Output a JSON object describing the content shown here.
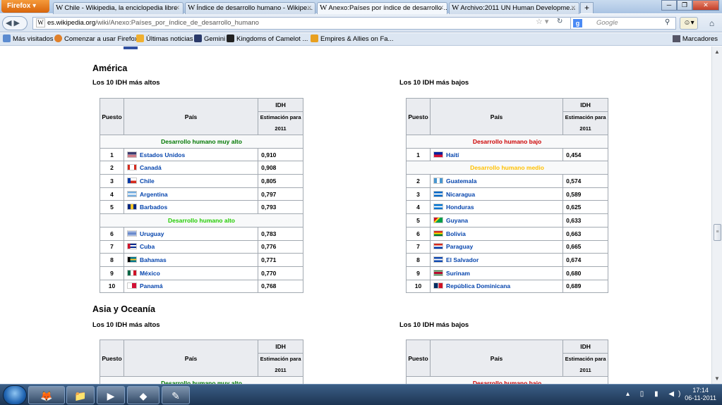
{
  "browser": {
    "menu_button": "Firefox ▾",
    "tabs": [
      {
        "label": "Chile - Wikipedia, la enciclopedia libre",
        "active": false
      },
      {
        "label": "Índice de desarrollo humano - Wikipe...",
        "active": false
      },
      {
        "label": "Anexo:Países por índice de desarrollo ...",
        "active": true
      },
      {
        "label": "Archivo:2011 UN Human Developme...",
        "active": false
      }
    ],
    "new_tab": "+",
    "url_domain": "es.wikipedia.org",
    "url_path": "/wiki/Anexo:Países_por_índice_de_desarrollo_humano",
    "search_placeholder": "Google",
    "bookmarks": [
      "Más visitados",
      "Comenzar a usar Firefox",
      "Últimas noticias",
      "Gemini",
      "Kingdoms of Camelot ...",
      "Empires & Allies on Fa..."
    ],
    "bookmarks_menu": "Marcadores"
  },
  "page": {
    "section1": {
      "heading": "América",
      "left_caption": "Los 10 IDH más altos",
      "right_caption": "Los 10 IDH más bajos",
      "col_puesto": "Puesto",
      "col_pais": "País",
      "col_idh": "IDH",
      "col_est": "Estimación para 2011",
      "left_groups": [
        {
          "category": "Desarrollo humano muy alto",
          "color": "#007700",
          "rows": [
            {
              "rank": "1",
              "country": "Estados Unidos",
              "value": "0,910"
            },
            {
              "rank": "2",
              "country": "Canadá",
              "value": "0,908"
            },
            {
              "rank": "3",
              "country": "Chile",
              "value": "0,805"
            },
            {
              "rank": "4",
              "country": "Argentina",
              "value": "0,797"
            },
            {
              "rank": "5",
              "country": "Barbados",
              "value": "0,793"
            }
          ]
        },
        {
          "category": "Desarrollo humano alto",
          "color": "#22cc00",
          "rows": [
            {
              "rank": "6",
              "country": "Uruguay",
              "value": "0,783"
            },
            {
              "rank": "7",
              "country": "Cuba",
              "value": "0,776"
            },
            {
              "rank": "8",
              "country": "Bahamas",
              "value": "0,771"
            },
            {
              "rank": "9",
              "country": "México",
              "value": "0,770"
            },
            {
              "rank": "10",
              "country": "Panamá",
              "value": "0,768"
            }
          ]
        }
      ],
      "right_groups": [
        {
          "category": "Desarrollo humano bajo",
          "color": "#cc0000",
          "rows": [
            {
              "rank": "1",
              "country": "Haití",
              "value": "0,454"
            }
          ]
        },
        {
          "category": "Desarrollo humano medio",
          "color": "#ffc000",
          "rows": [
            {
              "rank": "2",
              "country": "Guatemala",
              "value": "0,574"
            },
            {
              "rank": "3",
              "country": "Nicaragua",
              "value": "0,589"
            },
            {
              "rank": "4",
              "country": "Honduras",
              "value": "0,625"
            },
            {
              "rank": "5",
              "country": "Guyana",
              "value": "0,633"
            },
            {
              "rank": "6",
              "country": "Bolivia",
              "value": "0,663"
            },
            {
              "rank": "7",
              "country": "Paraguay",
              "value": "0,665"
            },
            {
              "rank": "8",
              "country": "El Salvador",
              "value": "0,674"
            },
            {
              "rank": "9",
              "country": "Surinam",
              "value": "0,680"
            },
            {
              "rank": "10",
              "country": "República Dominicana",
              "value": "0,689"
            }
          ]
        }
      ]
    },
    "section2": {
      "heading": "Asia y Oceanía",
      "left_caption": "Los 10 IDH más altos",
      "right_caption": "Los 10 IDH más bajos",
      "left_category": "Desarrollo humano muy alto",
      "right_category": "Desarrollo humano bajo"
    }
  },
  "taskbar": {
    "time": "17:14",
    "date": "06-11-2011"
  }
}
